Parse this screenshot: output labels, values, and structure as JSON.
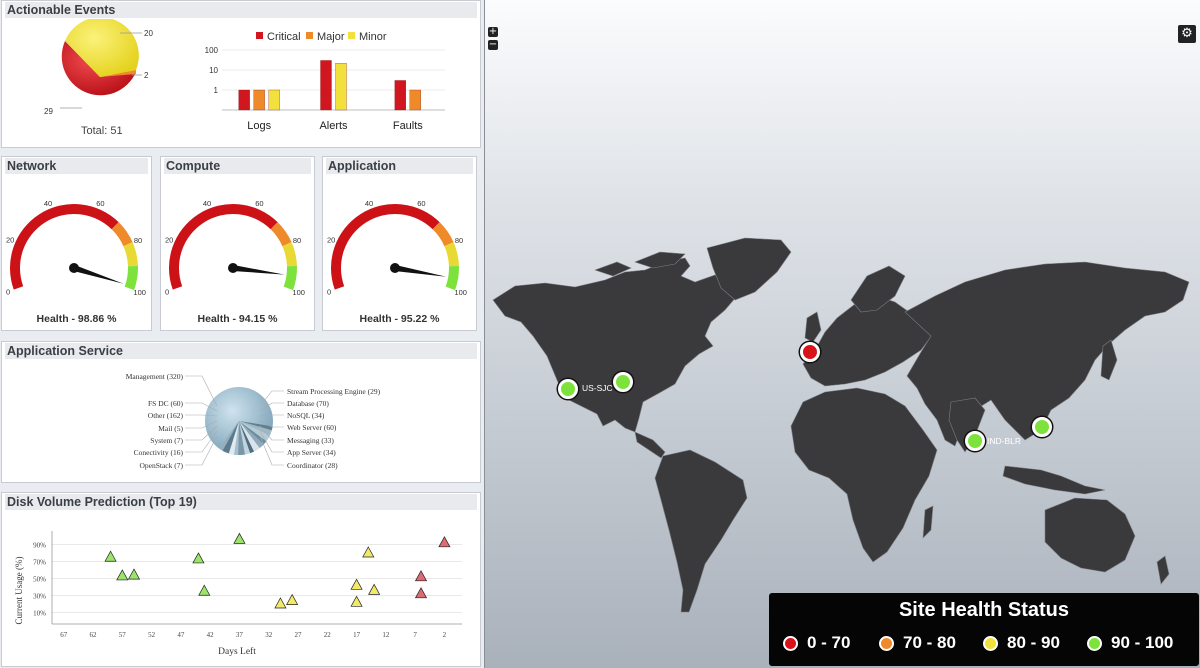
{
  "actionable_events": {
    "title": "Actionable Events",
    "total_label": "Total: 51",
    "pie_labels": [
      "20",
      "2",
      "29"
    ],
    "legend": [
      {
        "label": "Critical",
        "color": "#d0161f"
      },
      {
        "label": "Major",
        "color": "#ee8a2a"
      },
      {
        "label": "Minor",
        "color": "#f2e13c"
      }
    ],
    "chart_data": {
      "type": "bar",
      "categories": [
        "Logs",
        "Alerts",
        "Faults"
      ],
      "y_scale": "log",
      "yticks": [
        "100",
        "10",
        "1"
      ],
      "series": [
        {
          "name": "Critical",
          "values": [
            1,
            30,
            3
          ]
        },
        {
          "name": "Major",
          "values": [
            1,
            null,
            1
          ]
        },
        {
          "name": "Minor",
          "values": [
            1,
            22,
            null
          ]
        }
      ]
    }
  },
  "gauges": [
    {
      "title": "Network",
      "health": "Health - 98.86 %",
      "value": 98.86
    },
    {
      "title": "Compute",
      "health": "Health - 94.15 %",
      "value": 94.15
    },
    {
      "title": "Application",
      "health": "Health - 95.22 %",
      "value": 95.22
    }
  ],
  "gauge_ticks": [
    "0",
    "20",
    "40",
    "60",
    "80",
    "100"
  ],
  "app_service": {
    "title": "Application Service",
    "left_labels": [
      "Management (320)",
      "FS DC (60)",
      "Other (162)",
      "Mail (5)",
      "System (7)",
      "Conectivity (16)",
      "OpenStack (7)"
    ],
    "right_labels": [
      "Stream Processing Engine (29)",
      "Database (70)",
      "NoSQL (34)",
      "Web Server (60)",
      "Messaging (33)",
      "App Server (34)",
      "Coordinator (28)"
    ]
  },
  "disk": {
    "title": "Disk Volume Prediction (Top 19)",
    "ylabel": "Current Usage (%)",
    "xlabel": "Days Left",
    "yticks": [
      "90%",
      "70%",
      "50%",
      "30%",
      "10%"
    ],
    "xticks": [
      "67",
      "62",
      "57",
      "52",
      "47",
      "42",
      "37",
      "32",
      "27",
      "22",
      "17",
      "12",
      "7",
      "2"
    ],
    "chart_data": {
      "type": "scatter",
      "x_reversed": true,
      "xlim": [
        69,
        -1
      ],
      "ylim": [
        0,
        100
      ],
      "points": [
        {
          "x": 59,
          "y": 75,
          "c": "#9be36b"
        },
        {
          "x": 57,
          "y": 53,
          "c": "#9be36b"
        },
        {
          "x": 55,
          "y": 54,
          "c": "#9be36b"
        },
        {
          "x": 44,
          "y": 73,
          "c": "#9be36b"
        },
        {
          "x": 43,
          "y": 35,
          "c": "#9be36b"
        },
        {
          "x": 37,
          "y": 96,
          "c": "#9be36b"
        },
        {
          "x": 30,
          "y": 20,
          "c": "#f2e96a"
        },
        {
          "x": 28,
          "y": 24,
          "c": "#f2e96a"
        },
        {
          "x": 17,
          "y": 42,
          "c": "#f2e96a"
        },
        {
          "x": 17,
          "y": 22,
          "c": "#f2e96a"
        },
        {
          "x": 15,
          "y": 80,
          "c": "#f2e96a"
        },
        {
          "x": 14,
          "y": 36,
          "c": "#f2e96a"
        },
        {
          "x": 6,
          "y": 52,
          "c": "#dd6b73"
        },
        {
          "x": 6,
          "y": 32,
          "c": "#dd6b73"
        },
        {
          "x": 2,
          "y": 92,
          "c": "#dd6b73"
        }
      ]
    }
  },
  "map": {
    "zoom_in": "+",
    "zoom_out": "−",
    "gear_icon": "⚙",
    "sites": [
      {
        "label": "US-SJC",
        "status": "green",
        "color": "#7ee23c"
      },
      {
        "label": "",
        "status": "green",
        "color": "#7ee23c"
      },
      {
        "label": "",
        "status": "red",
        "color": "#d81219"
      },
      {
        "label": "IND-BLR",
        "status": "green",
        "color": "#7ee23c"
      },
      {
        "label": "",
        "status": "green",
        "color": "#7ee23c"
      }
    ],
    "legend": {
      "title": "Site Health Status",
      "items": [
        {
          "label": "0 - 70",
          "color": "#d81219"
        },
        {
          "label": "70 - 80",
          "color": "#ee8a2a"
        },
        {
          "label": "80 - 90",
          "color": "#f2e13c"
        },
        {
          "label": "90 - 100",
          "color": "#7ee23c"
        }
      ]
    }
  }
}
